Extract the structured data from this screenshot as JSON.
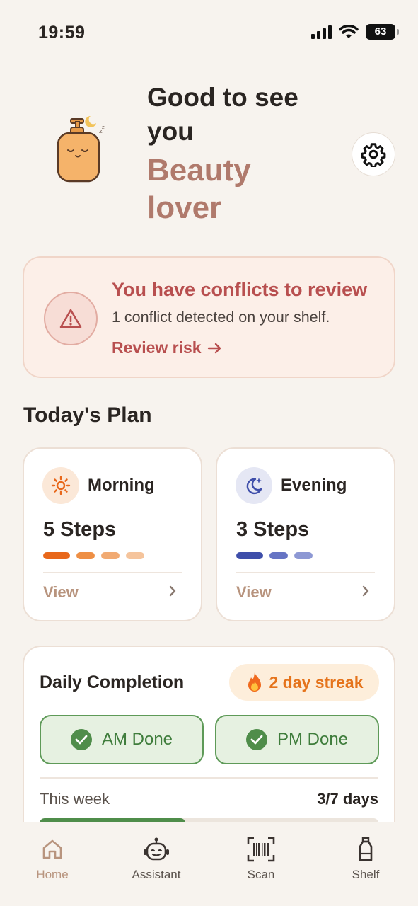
{
  "status_bar": {
    "time": "19:59",
    "battery": "63"
  },
  "header": {
    "greeting_line1": "Good to see",
    "greeting_line2": "you",
    "name_line1": "Beauty",
    "name_line2": "lover"
  },
  "conflict": {
    "title": "You have conflicts to review",
    "description": "1 conflict detected on your shelf.",
    "link": "Review risk"
  },
  "plan": {
    "section_title": "Today's Plan",
    "morning": {
      "name": "Morning",
      "steps": "5 Steps",
      "view": "View",
      "step_count": 4
    },
    "evening": {
      "name": "Evening",
      "steps": "3 Steps",
      "view": "View",
      "step_count": 3
    }
  },
  "daily": {
    "title": "Daily Completion",
    "streak": "2 day streak",
    "am_done": "AM Done",
    "pm_done": "PM Done",
    "week_label": "This week",
    "week_value": "3/7 days",
    "week_progress": 0.43
  },
  "nav": {
    "items": [
      {
        "label": "Home",
        "icon": "home-icon"
      },
      {
        "label": "Assistant",
        "icon": "robot-icon"
      },
      {
        "label": "Scan",
        "icon": "barcode-icon"
      },
      {
        "label": "Shelf",
        "icon": "bottle-icon"
      }
    ],
    "active": "Home"
  },
  "colors": {
    "accent": "#b07a6c",
    "danger": "#b84f4f",
    "success": "#4f8d4a",
    "streak": "#e5731b",
    "morning": "#e8671a",
    "evening": "#3e4eaa"
  }
}
